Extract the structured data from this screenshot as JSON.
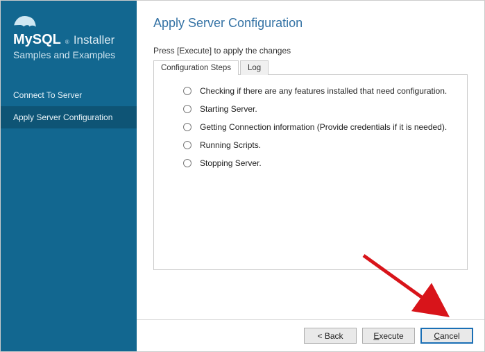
{
  "brand": {
    "name": "MySQL",
    "product": "Installer",
    "subtitle": "Samples and Examples"
  },
  "sidebar": {
    "items": [
      {
        "label": "Connect To Server",
        "active": false
      },
      {
        "label": "Apply Server Configuration",
        "active": true
      }
    ]
  },
  "main": {
    "title": "Apply Server Configuration",
    "instruction": "Press [Execute] to apply the changes",
    "tabs": [
      {
        "label": "Configuration Steps",
        "active": true
      },
      {
        "label": "Log",
        "active": false
      }
    ],
    "steps": [
      "Checking if there are any features installed that need configuration.",
      "Starting Server.",
      "Getting Connection information (Provide credentials if it is needed).",
      "Running Scripts.",
      "Stopping Server."
    ]
  },
  "footer": {
    "back": "< Back",
    "execute": "Execute",
    "cancel": "Cancel"
  }
}
